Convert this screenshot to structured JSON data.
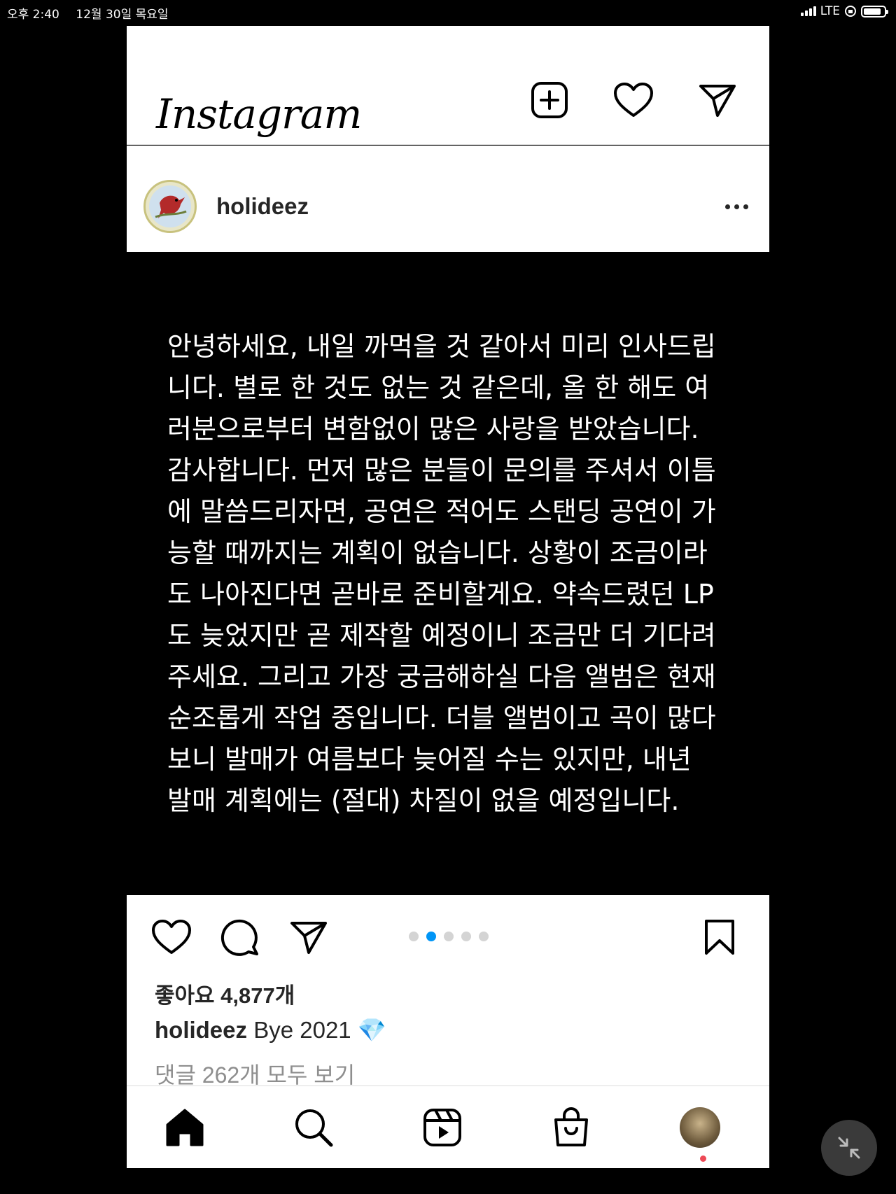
{
  "status_bar": {
    "time": "오후 2:40",
    "date": "12월 30일 목요일",
    "network": "LTE"
  },
  "header": {
    "logo": "Instagram",
    "icons": [
      "new-post-icon",
      "heart-icon",
      "direct-message-icon"
    ]
  },
  "post": {
    "username": "holideez",
    "text_lines": [
      "안녕하세요, 내일 까먹을 것 같아서 미리 인사드립",
      "니다. 별로 한 것도 없는 것 같은데, 올 한 해도 여",
      "러분으로부터 변함없이 많은 사랑을 받았습니다.",
      "감사합니다. 먼저 많은 분들이 문의를 주셔서 이틈",
      "에 말씀드리자면, 공연은 적어도 스탠딩 공연이 가",
      "능할 때까지는 계획이 없습니다. 상황이 조금이라",
      "도 나아진다면 곧바로 준비할게요. 약속드렸던 LP",
      "도 늦었지만 곧 제작할 예정이니 조금만 더 기다려",
      "주세요. 그리고 가장 궁금해하실 다음 앨범은 현재",
      "순조롭게 작업 중입니다. 더블 앨범이고 곡이 많다",
      "보니 발매가 여름보다 늦어질 수는 있지만, 내년",
      "발매 계획에는 (절대) 차질이 없을 예정입니다."
    ],
    "carousel": {
      "total": 5,
      "active_index": 1
    },
    "likes": "좋아요 4,877개",
    "caption_user": "holideez",
    "caption_text": "Bye 2021",
    "caption_emoji": "💎",
    "comments_link": "댓글 262개 모두 보기"
  },
  "tabs": [
    "home-icon",
    "search-icon",
    "reels-icon",
    "shop-icon",
    "profile-avatar"
  ],
  "colors": {
    "accent": "#0095f6",
    "notification": "#ed4956"
  }
}
